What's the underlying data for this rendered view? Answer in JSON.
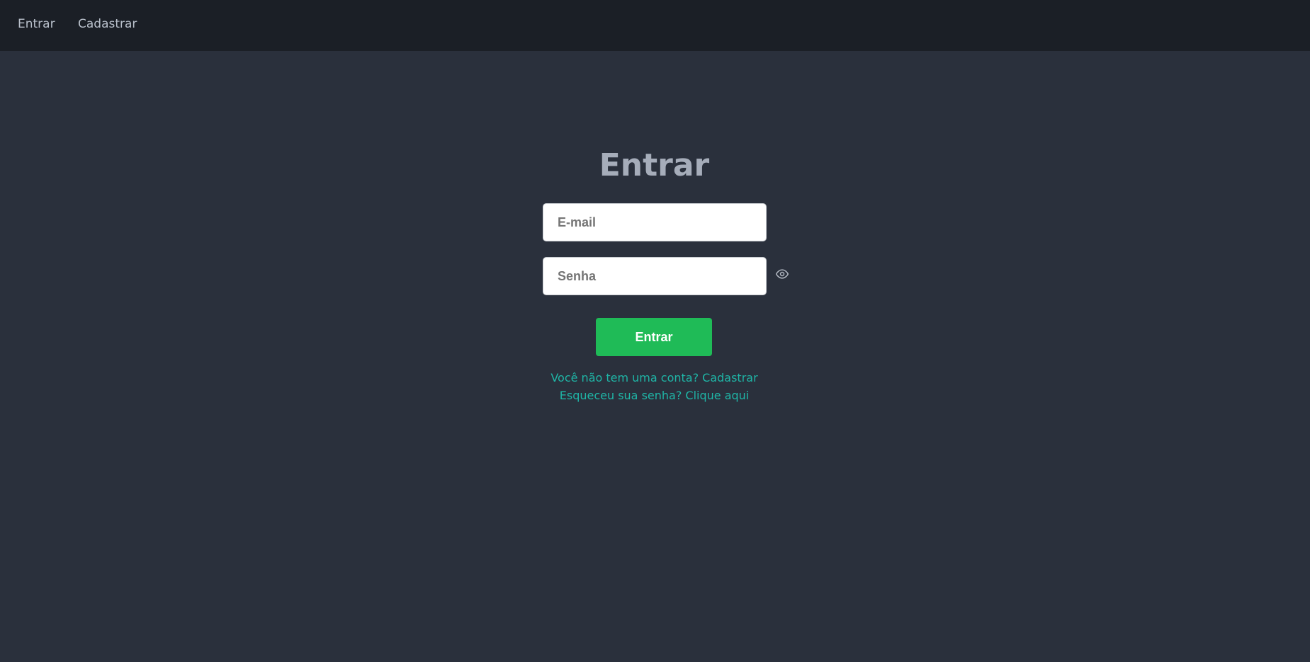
{
  "nav": {
    "items": [
      {
        "label": "Entrar"
      },
      {
        "label": "Cadastrar"
      }
    ]
  },
  "login": {
    "title": "Entrar",
    "email_placeholder": "E-mail",
    "password_placeholder": "Senha",
    "password_toggle_icon": "eye-icon",
    "submit_label": "Entrar",
    "signup_text": "Você não tem uma conta? Cadastrar",
    "forgot_text": "Esqueceu sua senha? Clique aqui"
  },
  "colors": {
    "topbar": "#1b1f26",
    "background": "#2a303c",
    "primary_button": "#1fbb57",
    "link": "#1fb5a6",
    "title": "#a6adba"
  }
}
